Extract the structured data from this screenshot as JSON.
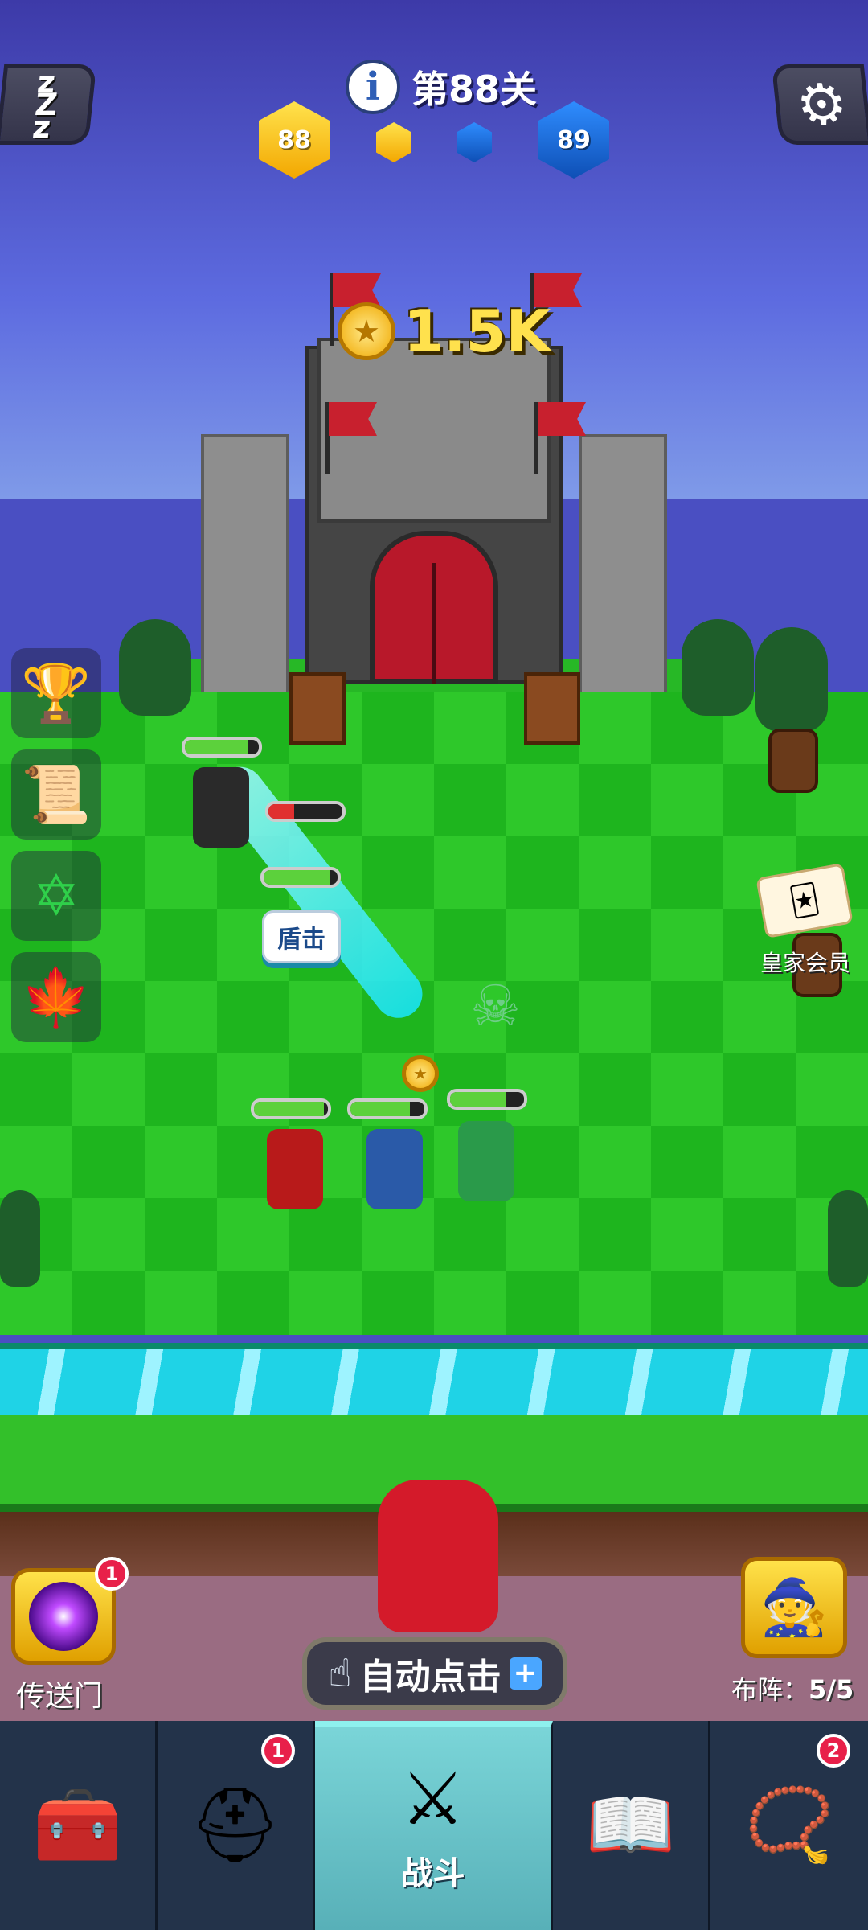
{
  "hud": {
    "level_text": "第88关",
    "player_level": "88",
    "enemy_level": "89",
    "info_icon": "i",
    "sleep_icon": "zzz-icon",
    "settings_icon": "gear-icon"
  },
  "castle": {
    "reward_text": "1.5K",
    "coin_icon": "coin-icon"
  },
  "battle": {
    "skill_popup": "盾击",
    "enemy_hp": 0.85,
    "enemy_damaged_hp": 0.35,
    "ally_hp": [
      0.9,
      0.95,
      0.8,
      0.75
    ]
  },
  "side_menu": [
    {
      "name": "ranking-icon"
    },
    {
      "name": "scroll-icon"
    },
    {
      "name": "hexagram-icon"
    },
    {
      "name": "red-maple-icon"
    }
  ],
  "royal": {
    "label": "皇家会员"
  },
  "actions": {
    "portal_label": "传送门",
    "portal_badge": "1",
    "auto_click_label": "自动点击",
    "auto_click_plus": "+",
    "formation_label": "布阵：",
    "formation_value": "5/5"
  },
  "nav": {
    "items": [
      {
        "icon": "treasure-chest-icon",
        "badge": ""
      },
      {
        "icon": "winged-helmet-icon",
        "badge": "1"
      },
      {
        "icon": "crossed-swords-icon",
        "label": "战斗",
        "active": true
      },
      {
        "icon": "spellbook-icon",
        "badge": ""
      },
      {
        "icon": "amulet-icon",
        "badge": "2"
      }
    ]
  },
  "colors": {
    "accent_gold": "#ffe14d",
    "ally_hex": "#f3a700",
    "enemy_hex": "#0e4fb5",
    "badge_red": "#e8204a"
  }
}
